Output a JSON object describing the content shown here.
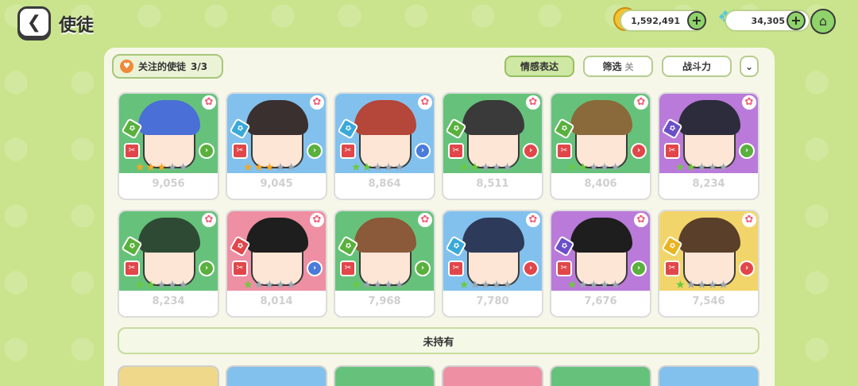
{
  "header": {
    "title": "使徒",
    "back_icon": "back-arrow-icon",
    "gold_amount": "1,592,491",
    "gem_amount": "34,305",
    "home_icon": "home-icon"
  },
  "toolbar": {
    "follow_label": "关注的使徒",
    "follow_count": "3/3",
    "emote_label": "情感表达",
    "filter_label": "筛选",
    "filter_state": "关",
    "power_label": "战斗力",
    "toggle_icon": "double-chevron-down-icon"
  },
  "owned_cards": [
    {
      "power": "9,056",
      "stars": 3,
      "star_color": "#f5a623",
      "art_color": "g",
      "hair": "#4a6fd6",
      "element": "#5ab03d",
      "arrow": "#5ab03d"
    },
    {
      "power": "9,045",
      "stars": 3,
      "star_color": "#f5a623",
      "art_color": "b",
      "hair": "#3a3030",
      "element": "#3aa9d9",
      "arrow": "#5ab03d"
    },
    {
      "power": "8,864",
      "stars": 2,
      "star_color": "#6bc93e",
      "art_color": "b",
      "hair": "#b4463a",
      "element": "#3aa9d9",
      "arrow": "#4a7bd8"
    },
    {
      "power": "8,511",
      "stars": 2,
      "star_color": "#6bc93e",
      "art_color": "g",
      "hair": "#3a3a3a",
      "element": "#5ab03d",
      "arrow": "#e1474a"
    },
    {
      "power": "8,406",
      "stars": 2,
      "star_color": "#6bc93e",
      "art_color": "g",
      "hair": "#8a6a3a",
      "element": "#5ab03d",
      "arrow": "#e1474a"
    },
    {
      "power": "8,234",
      "stars": 2,
      "star_color": "#6bc93e",
      "art_color": "p",
      "hair": "#2c2c3c",
      "element": "#6b4fc8",
      "arrow": "#5ab03d"
    },
    {
      "power": "8,234",
      "stars": 2,
      "star_color": "#6bc93e",
      "art_color": "g",
      "hair": "#2f4a34",
      "element": "#5ab03d",
      "arrow": "#5ab03d"
    },
    {
      "power": "8,014",
      "stars": 1,
      "star_color": "#6bc93e",
      "art_color": "pk",
      "hair": "#1e1e1e",
      "element": "#e1474a",
      "arrow": "#4a7bd8"
    },
    {
      "power": "7,968",
      "stars": 1,
      "star_color": "#6bc93e",
      "art_color": "g",
      "hair": "#8a5a3a",
      "element": "#5ab03d",
      "arrow": "#5ab03d"
    },
    {
      "power": "7,780",
      "stars": 1,
      "star_color": "#6bc93e",
      "art_color": "b",
      "hair": "#2e3a5a",
      "element": "#3aa9d9",
      "arrow": "#e1474a"
    },
    {
      "power": "7,676",
      "stars": 1,
      "star_color": "#6bc93e",
      "art_color": "p",
      "hair": "#1e1e1e",
      "element": "#6b4fc8",
      "arrow": "#5ab03d"
    },
    {
      "power": "7,546",
      "stars": 1,
      "star_color": "#6bc93e",
      "art_color": "y",
      "hair": "#5a3f2a",
      "element": "#e8b420",
      "arrow": "#e1474a"
    }
  ],
  "unowned_label": "未持有",
  "unowned_cards": [
    {
      "art_color": "#f0d88a"
    },
    {
      "art_color": "#82c1ed"
    },
    {
      "art_color": "#66c27a"
    },
    {
      "art_color": "#ee8fa3"
    },
    {
      "art_color": "#66c27a"
    },
    {
      "art_color": "#82c1ed"
    }
  ],
  "colors": {
    "background": "#c9e48c",
    "panel": "#f6f7e8",
    "accent_green": "#8fd36a"
  }
}
